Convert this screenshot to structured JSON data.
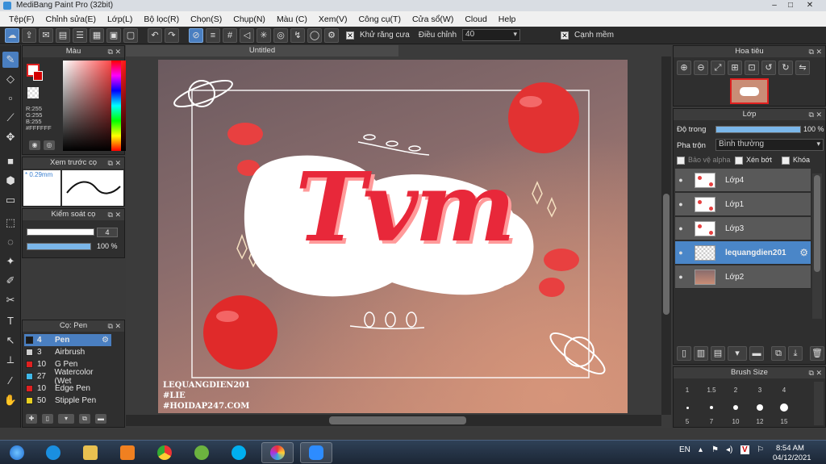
{
  "window": {
    "title": "MediBang Paint Pro (32bit)",
    "min": "–",
    "max": "□",
    "close": "✕"
  },
  "menu": [
    "Tệp(F)",
    "Chỉnh sửa(E)",
    "Lớp(L)",
    "Bộ lọc(R)",
    "Chọn(S)",
    "Chụp(N)",
    "Màu (C)",
    "Xem(V)",
    "Công cụ(T)",
    "Cửa sổ(W)",
    "Cloud",
    "Help"
  ],
  "toolbar": {
    "antialias_check": "✕",
    "antialias_label": "Khử răng cưa",
    "adjust_label": "Điều chỉnh",
    "adjust_value": "40",
    "sharp_check": "✕",
    "sharp_label": "Cạnh mềm"
  },
  "color_panel": {
    "title": "Màu",
    "r": "R:255",
    "g": "G:255",
    "b": "B:255",
    "hex": "#FFFFFF"
  },
  "preview_panel": {
    "title": "Xem trước cọ",
    "size": "0.29mm"
  },
  "brush_control": {
    "title": "Kiểm soát cọ",
    "size_value": "4",
    "opacity_value": "100 %"
  },
  "brush_panel": {
    "title": "Cọ: Pen",
    "items": [
      {
        "num": "4",
        "name": "Pen",
        "color": "#1a1a1a"
      },
      {
        "num": "3",
        "name": "Airbrush",
        "color": "#cfcfcf"
      },
      {
        "num": "10",
        "name": "G Pen",
        "color": "#e02020"
      },
      {
        "num": "27",
        "name": "Watercolor (Wet",
        "color": "#3fb8e8"
      },
      {
        "num": "10",
        "name": "Edge Pen",
        "color": "#e02020"
      },
      {
        "num": "50",
        "name": "Stipple Pen",
        "color": "#e8d020"
      }
    ]
  },
  "canvas": {
    "tab": "Untitled",
    "art_title": "Tvm",
    "watermark": [
      "LEQUANGDIEN201",
      "#LIE",
      "#HOIDAP247.COM"
    ]
  },
  "navigator": {
    "title": "Hoa tiêu"
  },
  "layers_panel": {
    "title": "Lớp",
    "opacity_label": "Độ trong",
    "opacity_value": "100 %",
    "blend_label": "Pha trộn",
    "blend_value": "Bình thường",
    "protect_alpha": "Bảo vệ alpha",
    "clipping": "Xén bớt",
    "lock": "Khóa",
    "layers": [
      {
        "name": "Lớp4",
        "thumb": "t-spot"
      },
      {
        "name": "Lớp1",
        "thumb": "t-spot"
      },
      {
        "name": "Lớp3",
        "thumb": "t-spot"
      },
      {
        "name": "lequangdien201",
        "thumb": "t-blank"
      },
      {
        "name": "Lớp2",
        "thumb": "t-photo"
      }
    ]
  },
  "brush_size_panel": {
    "title": "Brush Size",
    "row1": [
      "1",
      "1.5",
      "2",
      "3",
      "4"
    ],
    "row2": [
      "5",
      "7",
      "10",
      "12",
      "15"
    ]
  },
  "taskbar": {
    "lang": "EN",
    "time": "8:54 AM",
    "date": "04/12/2021"
  }
}
